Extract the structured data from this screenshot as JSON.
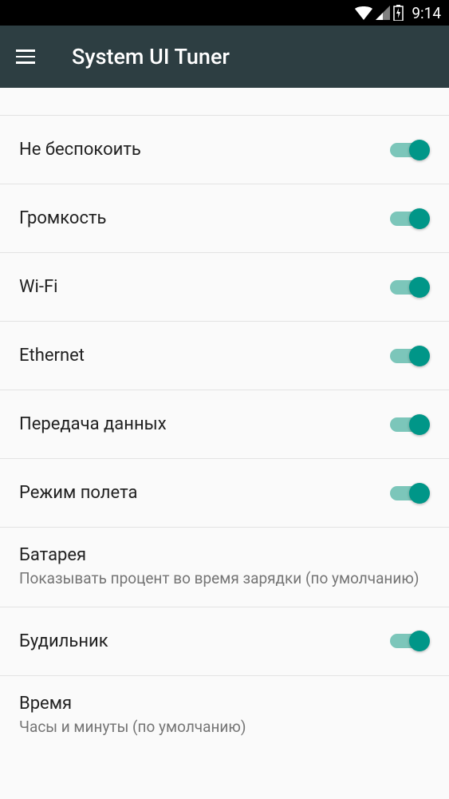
{
  "status_bar": {
    "time": "9:14"
  },
  "header": {
    "title": "System UI Tuner"
  },
  "items": [
    {
      "label": "Не беспокоить",
      "toggle": true
    },
    {
      "label": "Громкость",
      "toggle": true
    },
    {
      "label": "Wi-Fi",
      "toggle": true
    },
    {
      "label": "Ethernet",
      "toggle": true
    },
    {
      "label": "Передача данных",
      "toggle": true
    },
    {
      "label": "Режим полета",
      "toggle": true
    },
    {
      "label": "Батарея",
      "sublabel": "Показывать процент во время зарядки (по умолчанию)"
    },
    {
      "label": "Будильник",
      "toggle": true
    },
    {
      "label": "Время",
      "sublabel": "Часы и минуты (по умолчанию)"
    }
  ]
}
